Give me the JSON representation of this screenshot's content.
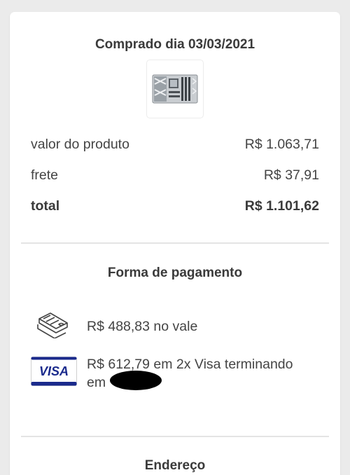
{
  "purchase": {
    "title": "Comprado dia 03/03/2021",
    "rows": [
      {
        "label": "valor do produto",
        "value": "R$ 1.063,71"
      },
      {
        "label": "frete",
        "value": "R$ 37,91"
      },
      {
        "label": "total",
        "value": "R$ 1.101,62"
      }
    ]
  },
  "payment": {
    "title": "Forma de pagamento",
    "methods": [
      {
        "icon": "voucher-icon",
        "text": "R$ 488,83 no vale"
      },
      {
        "icon": "visa-card-icon",
        "brand": "VISA",
        "text_line1": "R$ 612,79 em 2x Visa terminando",
        "text_line2": "em"
      }
    ]
  },
  "address": {
    "title": "Endereço"
  },
  "colors": {
    "visa_blue": "#1a2a8c",
    "visa_gold": "#f2a900",
    "divider": "#e4e4e4"
  }
}
